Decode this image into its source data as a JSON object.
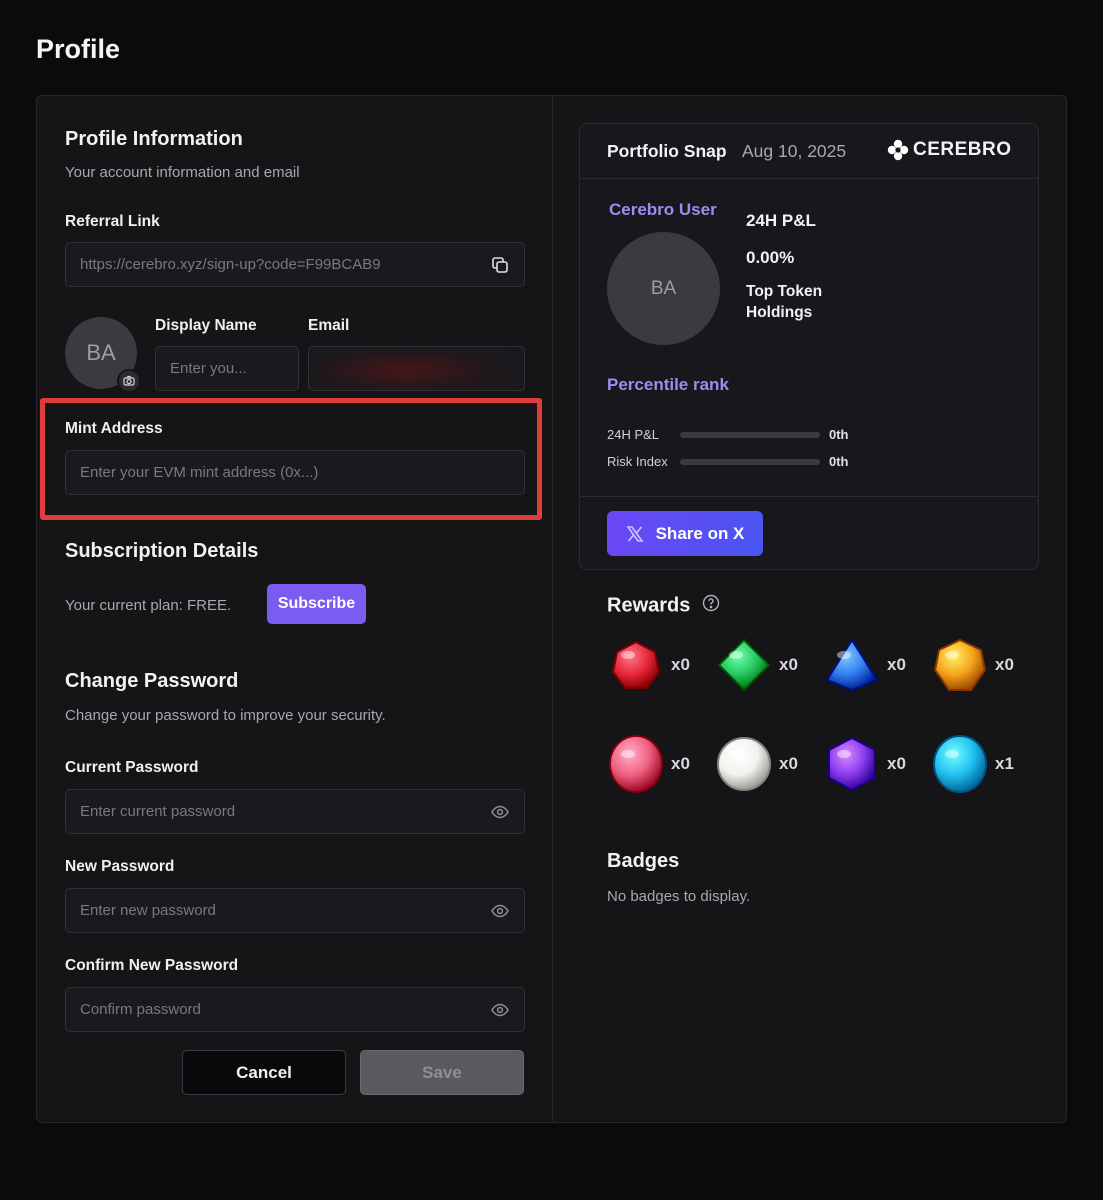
{
  "page_title": "Profile",
  "profile": {
    "heading": "Profile Information",
    "subheading": "Your account information and email",
    "referral_label": "Referral Link",
    "referral_value": "https://cerebro.xyz/sign-up?code=F99BCAB9",
    "avatar_initials": "BA",
    "display_name_label": "Display Name",
    "display_name_placeholder": "Enter you...",
    "email_label": "Email",
    "mint_label": "Mint Address",
    "mint_placeholder": "Enter your EVM mint address (0x...)"
  },
  "subscription": {
    "heading": "Subscription Details",
    "plan_text": "Your current plan: FREE.",
    "subscribe_label": "Subscribe"
  },
  "password": {
    "heading": "Change Password",
    "subheading": "Change your password to improve your security.",
    "current_label": "Current Password",
    "current_placeholder": "Enter current password",
    "new_label": "New Password",
    "new_placeholder": "Enter new password",
    "confirm_label": "Confirm New Password",
    "confirm_placeholder": "Confirm password",
    "cancel_label": "Cancel",
    "save_label": "Save"
  },
  "snap": {
    "title": "Portfolio Snap",
    "date": "Aug 10, 2025",
    "brand": "CEREBRO",
    "user_name": "Cerebro User",
    "avatar_initials": "BA",
    "pnl_label": "24H P&L",
    "pnl_value": "0.00%",
    "top_token_label": "Top Token Holdings",
    "percentile_heading": "Percentile rank",
    "ranks": [
      {
        "label": "24H P&L",
        "value": "0th",
        "fill": 0
      },
      {
        "label": "Risk Index",
        "value": "0th",
        "fill": 0
      }
    ],
    "share_label": "Share on X"
  },
  "rewards": {
    "heading": "Rewards",
    "gems": [
      {
        "name": "ruby",
        "color": "#e8283a",
        "count": "x0"
      },
      {
        "name": "emerald",
        "color": "#22c55e",
        "count": "x0"
      },
      {
        "name": "sapphire",
        "color": "#2f7bf0",
        "count": "x0"
      },
      {
        "name": "topaz",
        "color": "#f5a31a",
        "count": "x0"
      },
      {
        "name": "rose",
        "color": "#f0607e",
        "count": "x0"
      },
      {
        "name": "pearl",
        "color": "#f2f2ee",
        "count": "x0"
      },
      {
        "name": "amethyst",
        "color": "#8b3cf0",
        "count": "x0"
      },
      {
        "name": "aquamarine",
        "color": "#22c0f0",
        "count": "x1"
      }
    ]
  },
  "badges": {
    "heading": "Badges",
    "empty_text": "No badges to display."
  },
  "colors": {
    "accent": "#7b5cf0",
    "highlight": "#e23b3b"
  }
}
